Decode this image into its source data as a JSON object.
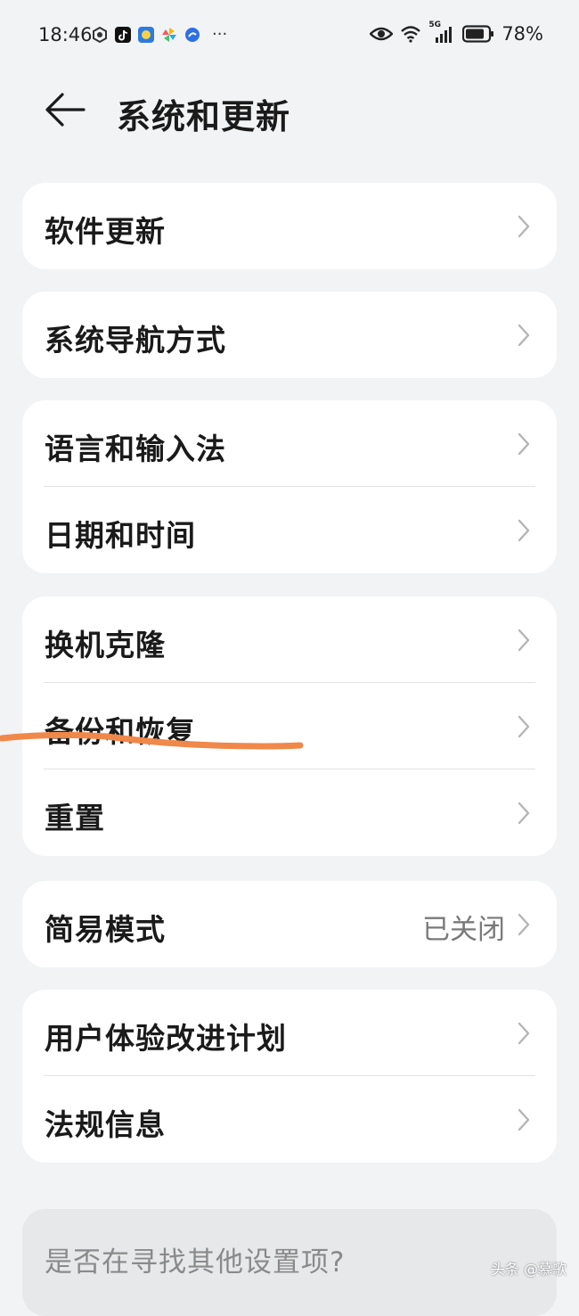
{
  "status_bar": {
    "time": "18:46",
    "battery": "78%",
    "network": "5G",
    "icons": [
      "hexagon-app-icon",
      "tiktok-icon",
      "gallery-icon",
      "pinwheel-icon",
      "blue-app-icon",
      "more-dots-icon",
      "eye-icon",
      "wifi-icon",
      "signal-icon",
      "battery-icon"
    ],
    "more": "···"
  },
  "header": {
    "title": "系统和更新"
  },
  "groups": [
    {
      "items": [
        {
          "label": "软件更新"
        }
      ]
    },
    {
      "items": [
        {
          "label": "系统导航方式"
        }
      ]
    },
    {
      "items": [
        {
          "label": "语言和输入法"
        },
        {
          "label": "日期和时间"
        }
      ]
    },
    {
      "items": [
        {
          "label": "换机克隆"
        },
        {
          "label": "备份和恢复"
        },
        {
          "label": "重置"
        }
      ]
    },
    {
      "items": [
        {
          "label": "简易模式",
          "value": "已关闭"
        }
      ]
    },
    {
      "items": [
        {
          "label": "用户体验改进计划"
        },
        {
          "label": "法规信息"
        }
      ]
    }
  ],
  "search_prompt": "是否在寻找其他设置项?",
  "watermark": "头条 @慕歌",
  "colors": {
    "background": "#f1f3f5",
    "card": "#ffffff",
    "annotation_stroke": "#f0884a"
  }
}
